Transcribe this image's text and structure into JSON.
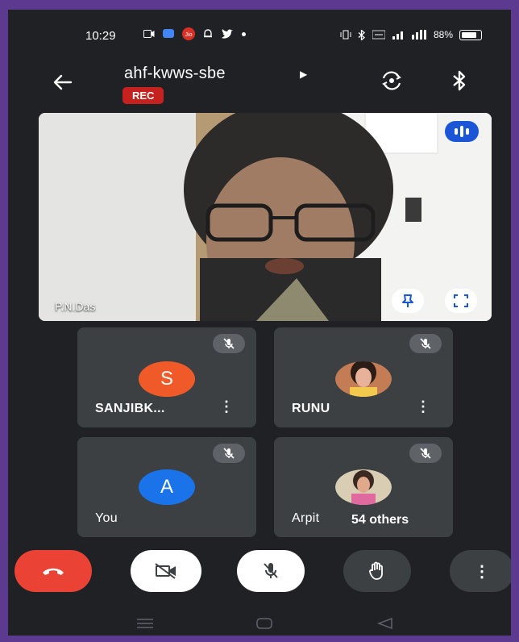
{
  "status_bar": {
    "time": "10:29",
    "left_icons": [
      "video-icon",
      "chat-icon",
      "jio-icon",
      "bell-icon",
      "twitter-icon",
      "dot-icon"
    ],
    "right_text": "88%",
    "right_icons": [
      "vibrate-icon",
      "bluetooth-icon",
      "volte-icon",
      "signal-icon",
      "4g-icon",
      "battery-icon"
    ]
  },
  "meeting": {
    "code": "ahf-kwws-sbe",
    "recording_badge": "REC"
  },
  "main_video": {
    "participant_name": "P.N.Das"
  },
  "participants": [
    {
      "name": "SANJIBK...",
      "avatar_letter": "S",
      "avatar_color": "#f05a28",
      "muted": true
    },
    {
      "name": "RUNU",
      "avatar_type": "photo",
      "muted": true
    },
    {
      "name": "You",
      "avatar_letter": "A",
      "avatar_color": "#1a73e8",
      "muted": true
    },
    {
      "name": "Arpit",
      "avatar_type": "photo",
      "muted": true
    }
  ],
  "others_chip": "54 others",
  "controls": {
    "end_call": "end-call-icon",
    "camera": "camera-off-icon",
    "microphone": "mic-off-icon",
    "raise_hand": "hand-icon",
    "more": "more-vert-icon"
  },
  "colors": {
    "background": "#202124",
    "tile": "#3c4043",
    "end_call": "#ea4335",
    "rec_badge": "#c5221f",
    "accent": "#1a56d6",
    "frame": "#5b3a8f"
  }
}
